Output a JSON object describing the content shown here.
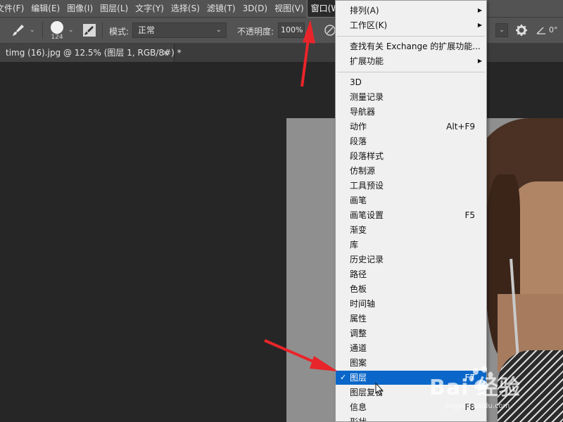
{
  "menubar": {
    "items": [
      "文件(F)",
      "编辑(E)",
      "图像(I)",
      "图层(L)",
      "文字(Y)",
      "选择(S)",
      "滤镜(T)",
      "3D(D)",
      "视图(V)",
      "窗口(W)"
    ],
    "active_index": 9
  },
  "options": {
    "brush_size": "124",
    "mode_label": "模式:",
    "mode_value": "正常",
    "opacity_label": "不透明度:",
    "opacity_value": "100%",
    "angle_value": "0°"
  },
  "tab": {
    "title": "timg (16).jpg @ 12.5% (图层 1, RGB/8#) *",
    "close": "×"
  },
  "window_menu": {
    "groups": [
      [
        {
          "label": "排列(A)",
          "submenu": true
        },
        {
          "label": "工作区(K)",
          "submenu": true
        }
      ],
      [
        {
          "label": "查找有关 Exchange 的扩展功能..."
        },
        {
          "label": "扩展功能",
          "submenu": true
        }
      ],
      [
        {
          "label": "3D"
        },
        {
          "label": "测量记录"
        },
        {
          "label": "导航器"
        },
        {
          "label": "动作",
          "shortcut": "Alt+F9"
        },
        {
          "label": "段落"
        },
        {
          "label": "段落样式"
        },
        {
          "label": "仿制源"
        },
        {
          "label": "工具预设"
        },
        {
          "label": "画笔"
        },
        {
          "label": "画笔设置",
          "shortcut": "F5"
        },
        {
          "label": "渐变"
        },
        {
          "label": "库"
        },
        {
          "label": "历史记录"
        },
        {
          "label": "路径"
        },
        {
          "label": "色板"
        },
        {
          "label": "时间轴"
        },
        {
          "label": "属性"
        },
        {
          "label": "调整"
        },
        {
          "label": "通道"
        },
        {
          "label": "图案"
        },
        {
          "label": "图层",
          "shortcut": "F7",
          "checked": true,
          "highlighted": true
        },
        {
          "label": "图层复合"
        },
        {
          "label": "信息",
          "shortcut": "F8"
        },
        {
          "label": "形状"
        }
      ]
    ]
  },
  "watermark": {
    "main": "Bai 经验",
    "sub": "jingyan.baidu.com"
  },
  "colors": {
    "menubar_bg": "#535353",
    "workspace_bg": "#262626",
    "menu_bg": "#f0f0f0",
    "highlight": "#0a67c9",
    "annotation_arrow": "#e8252a"
  },
  "icons": [
    "brush-icon",
    "brush-settings-icon",
    "airbrush-icon",
    "gear-icon",
    "angle-icon",
    "check-icon",
    "submenu-arrow-icon",
    "mouse-cursor-icon",
    "baidu-paw-icon"
  ]
}
